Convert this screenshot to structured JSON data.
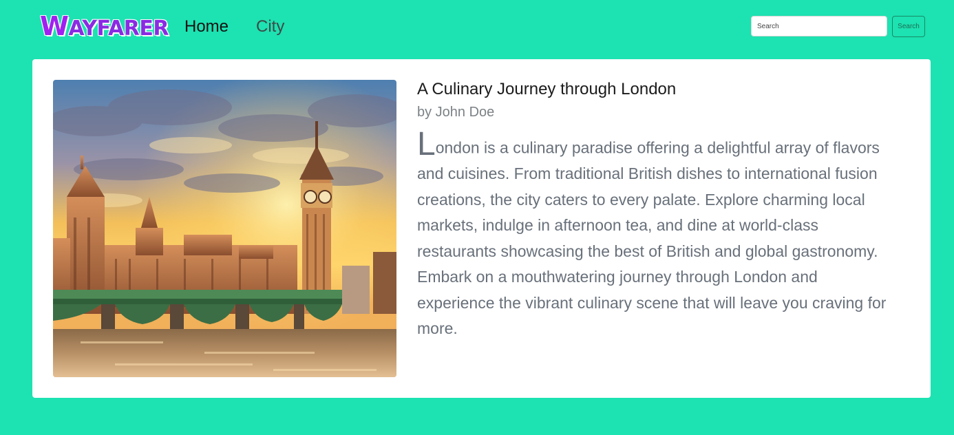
{
  "brand": {
    "first_letter": "W",
    "rest": "AYFARER",
    "color": "#a020f0"
  },
  "nav": {
    "items": [
      {
        "label": "Home"
      },
      {
        "label": "City"
      }
    ]
  },
  "search": {
    "placeholder": "Search",
    "button_label": "Search"
  },
  "theme": {
    "background": "#1de2b1",
    "card": "#ffffff"
  },
  "article": {
    "title": "A Culinary Journey through London",
    "author": "by John Doe",
    "image_subject": "Big Ben and the Houses of Parliament with Westminster Bridge at sunset",
    "drop_cap": "L",
    "body": "ondon is a culinary paradise offering a delightful array of flavors and cuisines. From traditional British dishes to international fusion creations, the city caters to every palate. Explore charming local markets, indulge in afternoon tea, and dine at world-class restaurants showcasing the best of British and global gastronomy. Embark on a mouthwatering journey through London and experience the vibrant culinary scene that will leave you craving for more."
  }
}
